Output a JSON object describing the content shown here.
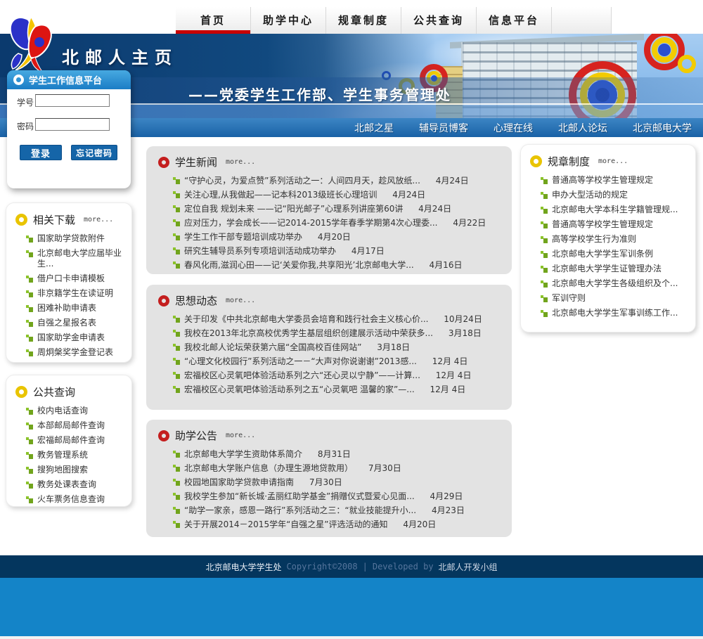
{
  "header": {
    "site_title": "北邮人主页"
  },
  "topnav": {
    "tabs": [
      {
        "label": "首页",
        "active": true
      },
      {
        "label": "助学中心",
        "active": false
      },
      {
        "label": "规章制度",
        "active": false
      },
      {
        "label": "公共查询",
        "active": false
      },
      {
        "label": "信息平台",
        "active": false
      }
    ]
  },
  "banner": {
    "slogan": "——党委学生工作部、学生事务管理处"
  },
  "subnav": {
    "links": [
      "北邮之星",
      "辅导员博客",
      "心理在线",
      "北邮人论坛",
      "北京邮电大学"
    ]
  },
  "login": {
    "title": "学生工作信息平台",
    "student_id_label": "学号",
    "password_label": "密码",
    "student_id_value": "",
    "password_value": "",
    "login_button": "登录",
    "forgot_button": "忘记密码"
  },
  "downloads": {
    "title": "相关下载",
    "more": "more...",
    "items": [
      "国家助学贷款附件",
      "北京邮电大学应届毕业生...",
      "借户口卡申请模板",
      "非京籍学生在读证明",
      "困难补助申请表",
      "自强之星报名表",
      "国家助学金申请表",
      "周炯槃奖学金登记表"
    ]
  },
  "queries": {
    "title": "公共查询",
    "items": [
      "校内电话查询",
      "本部邮局邮件查询",
      "宏福邮局邮件查询",
      "教务管理系统",
      "搜狗地图搜索",
      "教务处课表查询",
      "火车票务信息查询"
    ]
  },
  "news": {
    "title": "学生新闻",
    "more": "more...",
    "items": [
      {
        "text": "“守护心灵，为爱点赞”系列活动之一：人间四月天，趁风放纸...",
        "date": "4月24日"
      },
      {
        "text": "关注心理,从我做起——记本科2013级班长心理培训",
        "date": "4月24日"
      },
      {
        "text": "定位自我 规划未来 ——记“阳光邮子”心理系列讲座第60讲",
        "date": "4月24日"
      },
      {
        "text": "应对压力，学会成长——记2014-2015学年春季学期第4次心理委...",
        "date": "4月22日"
      },
      {
        "text": "学生工作干部专题培训成功举办",
        "date": "4月20日"
      },
      {
        "text": "研究生辅导员系列专项培训活动成功举办",
        "date": "4月17日"
      },
      {
        "text": "春风化雨,滋润心田——记‘关爱你我,共享阳光’北京邮电大学...",
        "date": "4月16日"
      }
    ]
  },
  "trends": {
    "title": "思想动态",
    "more": "more...",
    "items": [
      {
        "text": "关于印发《中共北京邮电大学委员会培育和践行社会主义核心价...",
        "date": "10月24日"
      },
      {
        "text": "我校在2013年北京高校优秀学生基层组织创建展示活动中荣获多...",
        "date": "3月18日"
      },
      {
        "text": "我校北邮人论坛荣获第六届“全国高校百佳网站”",
        "date": "3月18日"
      },
      {
        "text": "“心理文化校园行”系列活动之一－“大声对你说谢谢”2013感...",
        "date": "12月 4日"
      },
      {
        "text": "宏福校区心灵氧吧体验活动系列之六“还心灵以宁静”——计算...",
        "date": "12月 4日"
      },
      {
        "text": "宏福校区心灵氧吧体验活动系列之五“心灵氧吧 温馨的家”—...",
        "date": "12月 4日"
      }
    ]
  },
  "aid": {
    "title": "助学公告",
    "more": "more...",
    "items": [
      {
        "text": "北京邮电大学学生资助体系简介",
        "date": "8月31日"
      },
      {
        "text": "北京邮电大学账户信息（办理生源地贷款用）",
        "date": "7月30日"
      },
      {
        "text": "校园地国家助学贷款申请指南",
        "date": "7月30日"
      },
      {
        "text": "我校学生参加“新长城·孟丽红助学基金”捐赠仪式暨爱心见面...",
        "date": "4月29日"
      },
      {
        "text": "“助学一家亲，感恩一路行”系列活动之三：“就业技能提升小...",
        "date": "4月23日"
      },
      {
        "text": "关于开展2014－2015学年“自强之星”评选活动的通知",
        "date": "4月20日"
      }
    ]
  },
  "regulations": {
    "title": "规章制度",
    "more": "more...",
    "items": [
      "普通高等学校学生管理规定",
      "申办大型活动的规定",
      "北京邮电大学本科生学籍管理规...",
      "普通高等学校学生管理规定",
      "高等学校学生行为准则",
      "北京邮电大学学生军训条例",
      "北京邮电大学学生证管理办法",
      "北京邮电大学学生各级组织及个...",
      "军训守则",
      "北京邮电大学学生军事训练工作..."
    ]
  },
  "footer": {
    "unit": "北京邮电大学学生处",
    "copyright": "Copyright©2008",
    "divider": "|",
    "developed_by": "Developed by",
    "team": "北邮人开发小组"
  },
  "colors": {
    "active_tab_underline": "#c80000",
    "subnav_blue": "#1a62a6",
    "button_blue": "#1565a8",
    "bullet_green": "#8bc32a",
    "ring_red": "#c41e1e",
    "ring_yellow": "#e9c400",
    "footer_navy": "#04365e",
    "footer_blue": "#1484c8"
  }
}
